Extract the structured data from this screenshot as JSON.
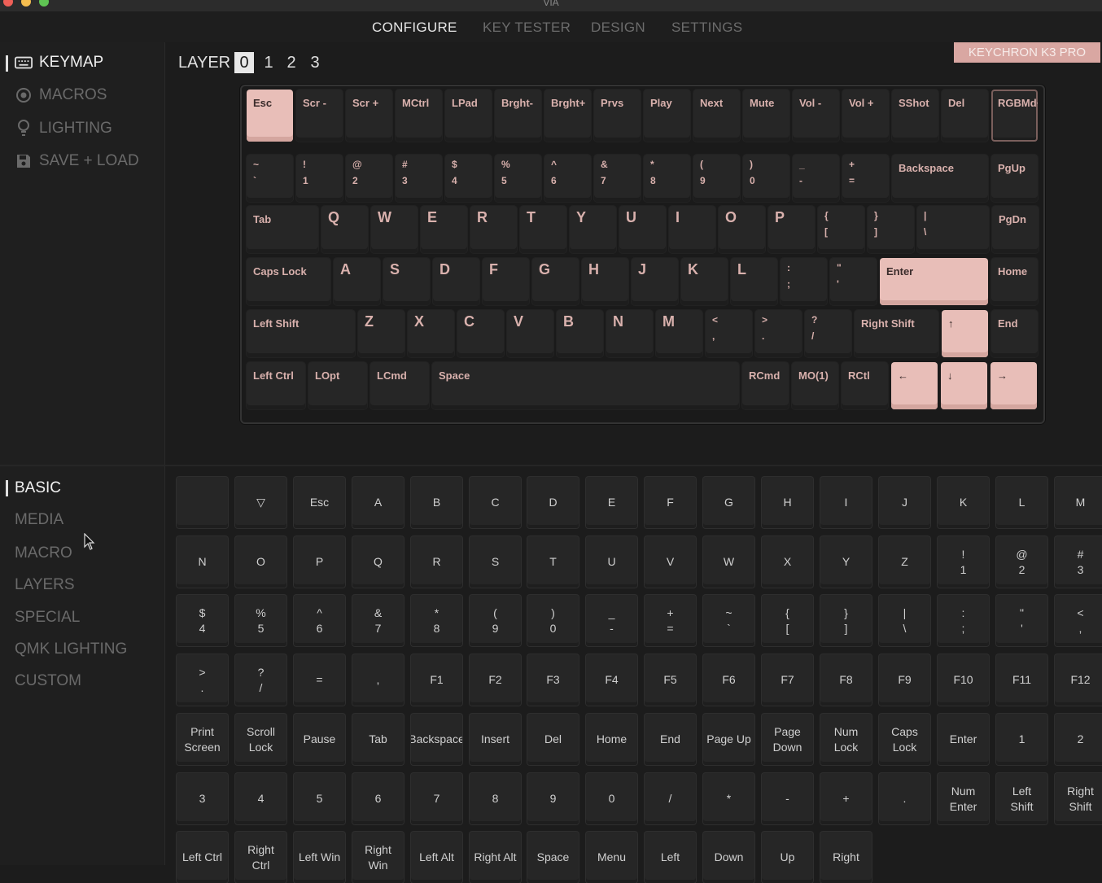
{
  "window": {
    "title": "VIA"
  },
  "colors": {
    "accent": "#e8beb8",
    "badge": "#d9a7a2",
    "background": "#1c1c1c",
    "key": "#262626"
  },
  "nav": [
    {
      "label": "CONFIGURE",
      "active": true
    },
    {
      "label": "KEY TESTER"
    },
    {
      "label": "DESIGN"
    },
    {
      "label": "SETTINGS"
    }
  ],
  "sidebar": {
    "items": [
      {
        "label": "KEYMAP",
        "icon": "keyboard-icon",
        "active": true
      },
      {
        "label": "MACROS",
        "icon": "record-icon"
      },
      {
        "label": "LIGHTING",
        "icon": "bulb-icon"
      },
      {
        "label": "SAVE + LOAD",
        "icon": "save-icon"
      }
    ]
  },
  "layers": {
    "label": "LAYER",
    "numbers": [
      "0",
      "1",
      "2",
      "3"
    ],
    "selected": "0"
  },
  "keyboard_name": "KEYCHRON K3 PRO",
  "keyboard": {
    "row0": [
      "Esc",
      "Scr -",
      "Scr +",
      "MCtrl",
      "LPad",
      "Brght-",
      "Brght+",
      "Prvs",
      "Play",
      "Next",
      "Mute",
      "Vol -",
      "Vol +",
      "SShot",
      "Del",
      "RGBMd+"
    ],
    "row1": [
      [
        "~",
        "`"
      ],
      [
        "!",
        "1"
      ],
      [
        "@",
        "2"
      ],
      [
        "#",
        "3"
      ],
      [
        "$",
        "4"
      ],
      [
        "%",
        "5"
      ],
      [
        "^",
        "6"
      ],
      [
        "&",
        "7"
      ],
      [
        "*",
        "8"
      ],
      [
        "(",
        "9"
      ],
      [
        ")",
        "0"
      ],
      [
        "_",
        "-"
      ],
      [
        "+",
        "="
      ],
      "Backspace",
      "PgUp"
    ],
    "row2": [
      "Tab",
      "Q",
      "W",
      "E",
      "R",
      "T",
      "Y",
      "U",
      "I",
      "O",
      "P",
      [
        "{",
        "["
      ],
      [
        "}",
        "]"
      ],
      [
        "|",
        "\\"
      ],
      "PgDn"
    ],
    "row3": [
      "Caps Lock",
      "A",
      "S",
      "D",
      "F",
      "G",
      "H",
      "J",
      "K",
      "L",
      [
        ":",
        ";"
      ],
      [
        "\"",
        "'"
      ],
      "Enter",
      "Home"
    ],
    "row4": [
      "Left Shift",
      "Z",
      "X",
      "C",
      "V",
      "B",
      "N",
      "M",
      [
        "<",
        ","
      ],
      [
        ">",
        "."
      ],
      [
        "?",
        "/"
      ],
      "Right Shift",
      "↑",
      "End"
    ],
    "row5": [
      "Left Ctrl",
      "LOpt",
      "LCmd",
      "Space",
      "RCmd",
      "MO(1)",
      "RCtl",
      "←",
      "↓",
      "→"
    ]
  },
  "categories": [
    {
      "label": "BASIC",
      "active": true
    },
    {
      "label": "MEDIA"
    },
    {
      "label": "MACRO"
    },
    {
      "label": "LAYERS"
    },
    {
      "label": "SPECIAL"
    },
    {
      "label": "QMK LIGHTING"
    },
    {
      "label": "CUSTOM"
    }
  ],
  "palette": [
    [
      "",
      "▽",
      "Esc",
      "A",
      "B",
      "C",
      "D",
      "E",
      "F",
      "G",
      "H",
      "I",
      "J",
      "K",
      "L",
      "M"
    ],
    [
      "N",
      "O",
      "P",
      "Q",
      "R",
      "S",
      "T",
      "U",
      "V",
      "W",
      "X",
      "Y",
      "Z",
      [
        "!",
        "1"
      ],
      [
        "@",
        "2"
      ],
      [
        "#",
        "3"
      ]
    ],
    [
      [
        "$",
        "4"
      ],
      [
        "%",
        "5"
      ],
      [
        "^",
        "6"
      ],
      [
        "&",
        "7"
      ],
      [
        "*",
        "8"
      ],
      [
        "(",
        "9"
      ],
      [
        ")",
        "0"
      ],
      [
        "_",
        "-"
      ],
      [
        "+",
        "="
      ],
      [
        "~",
        "`"
      ],
      [
        "{",
        "["
      ],
      [
        "}",
        "]"
      ],
      [
        "|",
        "\\"
      ],
      [
        ":",
        ";"
      ],
      [
        "\"",
        "'"
      ],
      [
        "<",
        ","
      ]
    ],
    [
      [
        ">",
        "."
      ],
      [
        "?",
        "/"
      ],
      "=",
      ",",
      "F1",
      "F2",
      "F3",
      "F4",
      "F5",
      "F6",
      "F7",
      "F8",
      "F9",
      "F10",
      "F11",
      "F12"
    ],
    [
      [
        "Print",
        "Screen"
      ],
      [
        "Scroll",
        "Lock"
      ],
      "Pause",
      "Tab",
      "Backspace",
      "Insert",
      "Del",
      "Home",
      "End",
      "Page Up",
      [
        "Page",
        "Down"
      ],
      [
        "Num",
        "Lock"
      ],
      [
        "Caps",
        "Lock"
      ],
      "Enter",
      "1",
      "2"
    ],
    [
      "3",
      "4",
      "5",
      "6",
      "7",
      "8",
      "9",
      "0",
      "/",
      "*",
      "-",
      "+",
      ".",
      [
        "Num",
        "Enter"
      ],
      [
        "Left",
        "Shift"
      ],
      [
        "Right",
        "Shift"
      ]
    ],
    [
      "Left Ctrl",
      [
        "Right",
        "Ctrl"
      ],
      "Left Win",
      [
        "Right",
        "Win"
      ],
      "Left Alt",
      "Right Alt",
      "Space",
      "Menu",
      "Left",
      "Down",
      "Up",
      "Right"
    ]
  ]
}
